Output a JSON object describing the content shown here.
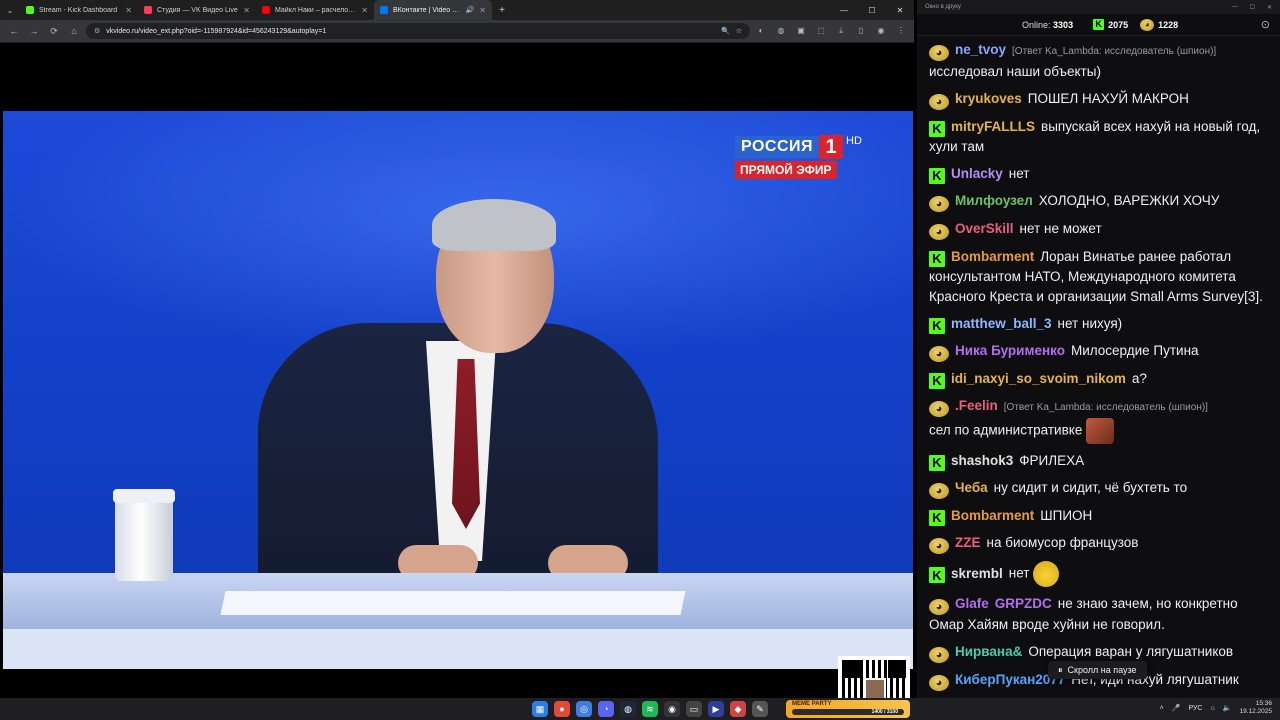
{
  "browser": {
    "tabs": [
      {
        "title": "Stream - Kick Dashboard",
        "favicon_color": "#53fc18",
        "active": false
      },
      {
        "title": "Студия — VK Видео Live",
        "favicon_color": "#ff3b5c",
        "active": false
      },
      {
        "title": "Майкл Наки – расчеловечива...",
        "favicon_color": "#ff0000",
        "active": false
      },
      {
        "title": "ВКонтакте | Video Ext",
        "favicon_color": "#0077ff",
        "active": true
      }
    ],
    "url": "vkvideo.ru/video_ext.php?oid=-115987924&id=456243129&autoplay=1"
  },
  "video": {
    "channel_name": "РОССИЯ",
    "channel_number": "1",
    "channel_hd": "HD",
    "live_label": "ПРЯМОЙ ЭФИР"
  },
  "chat": {
    "window_title": "Окно в друку",
    "online_label": "Online:",
    "online_count": "3303",
    "kick_count": "2075",
    "vk_count": "1228",
    "scroll_paused_label": "Скролл на паузе",
    "messages": [
      {
        "platform": "vk",
        "user": "ne_tvoy",
        "color": "#8aa4ff",
        "reply": "[Ответ Ka_Lambda: исследователь (шпион)]",
        "text": "исследовал наши объекты)"
      },
      {
        "platform": "vk",
        "user": "kryukoves",
        "color": "#e6b24a",
        "reply": "",
        "text": "ПОШЕЛ НАХУЙ МАКРОН"
      },
      {
        "platform": "kick",
        "user": "mitryFALLLS",
        "color": "#e6b24a",
        "reply": "",
        "text": "выпускай всех нахуй на новый год, хули там"
      },
      {
        "platform": "kick",
        "user": "Unlacky",
        "color": "#b48ef5",
        "reply": "",
        "text": "нет"
      },
      {
        "platform": "vk",
        "user": "Милфоузел",
        "color": "#6cc26c",
        "reply": "",
        "text": "ХОЛОДНО, ВАРЕЖКИ ХОЧУ"
      },
      {
        "platform": "vk",
        "user": "OverSkill",
        "color": "#e8607a",
        "reply": "",
        "text": "нет не может"
      },
      {
        "platform": "kick",
        "user": "Bombarment",
        "color": "#e69b3a",
        "reply": "",
        "text": "Лоран Винатье ранее работал консультантом НАТО, Международного комитета Красного Креста и организации Small Arms Survey[3]."
      },
      {
        "platform": "kick",
        "user": "matthew_ball_3",
        "color": "#8fb7ff",
        "reply": "",
        "text": "нет нихуя)"
      },
      {
        "platform": "vk",
        "user": "Ника Бурименко",
        "color": "#b66cf0",
        "reply": "",
        "text": "Милосердие Путина"
      },
      {
        "platform": "kick",
        "user": "idi_naxyi_so_svoim_nikom",
        "color": "#e6b24a",
        "reply": "",
        "text": "а?"
      },
      {
        "platform": "vk",
        "user": ".Feelin",
        "color": "#e8607a",
        "reply": "[Ответ Ka_Lambda: исследователь (шпион)]",
        "text": "сел по административке",
        "emote": "face"
      },
      {
        "platform": "kick",
        "user": "shashok3",
        "color": "#e0e0e0",
        "reply": "",
        "text": "ФРИЛЕХА"
      },
      {
        "platform": "vk",
        "user": "Чеба",
        "color": "#e6b24a",
        "reply": "",
        "text": "ну сидит и сидит, чё бухтеть то"
      },
      {
        "platform": "kick",
        "user": "Bombarment",
        "color": "#e69b3a",
        "reply": "",
        "text": "ШПИОН"
      },
      {
        "platform": "vk",
        "user": "ZZE",
        "color": "#e8607a",
        "reply": "",
        "text": "на биомусор французов"
      },
      {
        "platform": "kick",
        "user": "skrembl",
        "color": "#e0e0e0",
        "reply": "",
        "text": "нет",
        "emote": "yellow"
      },
      {
        "platform": "vk",
        "user": "Glafe",
        "color": "#b66cf0",
        "user2": "GRPZDC",
        "reply": "",
        "text": "не знаю зачем, но конкретно Омар Хайям вроде хуйни не говорил."
      },
      {
        "platform": "vk",
        "user": "Нирвана&",
        "color": "#4fc9a8",
        "reply": "",
        "text": "Операция варан у лягушатников"
      },
      {
        "platform": "vk",
        "user": "КиберПукан2077",
        "color": "#5aa0ff",
        "reply": "",
        "text": "Нет, иди нахуй лягушатник"
      }
    ]
  },
  "taskbar": {
    "widget_label": "MEME PARTY",
    "widget_value": "1400 / 3100",
    "lang": "РУС",
    "time": "15:36",
    "date": "19.12.2025"
  }
}
